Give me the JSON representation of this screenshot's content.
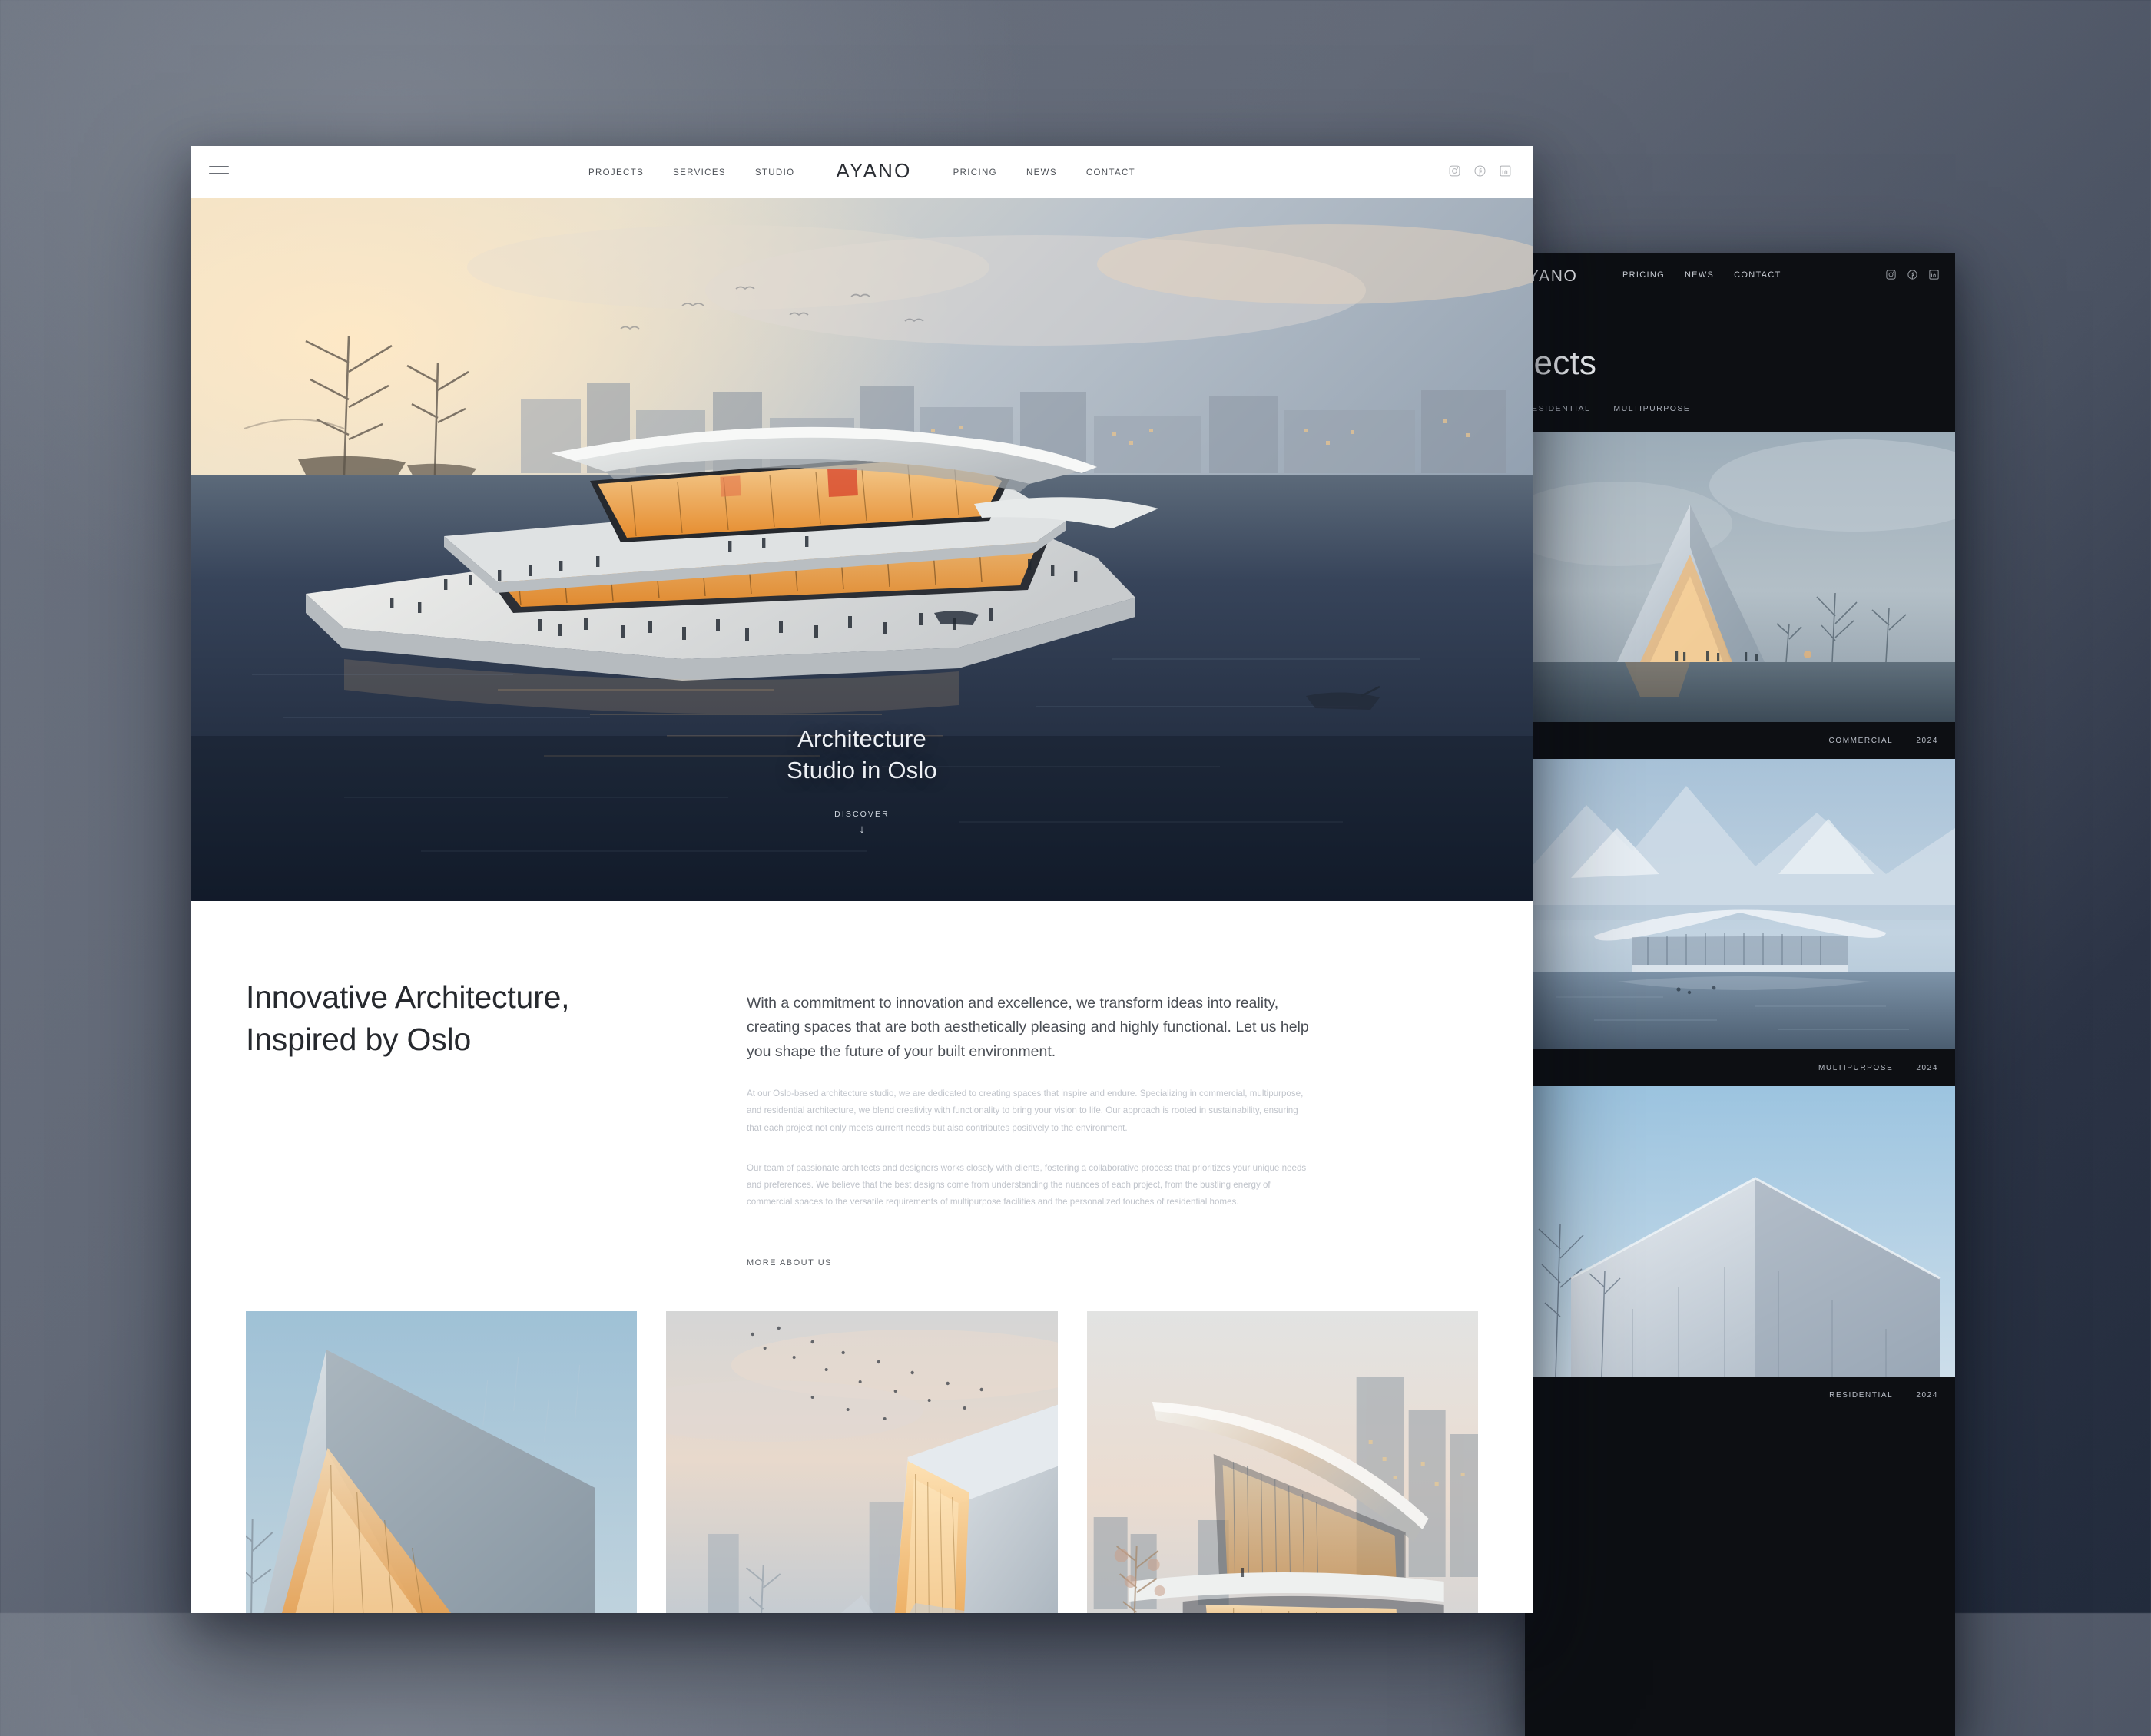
{
  "theme": {
    "page_bg_from": "#6d7481",
    "page_bg_to": "#222b3c",
    "light_surface": "#ffffff",
    "dark_surface": "#0d0f13",
    "accent_text": "#26292e"
  },
  "front_window": {
    "header": {
      "menu_icon": "hamburger-icon",
      "brand": "AYANO",
      "nav_left": [
        "PROJECTS",
        "SERVICES",
        "STUDIO"
      ],
      "nav_right": [
        "PRICING",
        "NEWS",
        "CONTACT"
      ],
      "socials": [
        "instagram-icon",
        "facebook-icon",
        "linkedin-icon"
      ]
    },
    "hero": {
      "title_line1": "Architecture",
      "title_line2": "Studio in Oslo",
      "discover_label": "DISCOVER",
      "scroll_arrow": "arrow-down-icon"
    },
    "about": {
      "heading_line1": "Innovative Architecture,",
      "heading_line2": "Inspired by Oslo",
      "lead": "With a commitment to innovation and excellence, we transform ideas into reality, creating spaces that are both aesthetically pleasing and highly functional. Let us help you shape the future of your built environment.",
      "paragraph1": "At our Oslo-based architecture studio, we are dedicated to creating spaces that inspire and endure. Specializing in commercial, multipurpose, and residential architecture, we blend creativity with functionality to bring your vision to life. Our approach is rooted in sustainability, ensuring that each project not only meets current needs but also contributes positively to the environment.",
      "paragraph2": "Our team of passionate architects and designers works closely with clients, fostering a collaborative process that prioritizes your unique needs and preferences. We believe that the best designs come from understanding the nuances of each project, from the bustling energy of commercial spaces to the versatile requirements of multipurpose facilities and the personalized touches of residential homes.",
      "cta_label": "MORE ABOUT US"
    },
    "gallery": [
      {
        "name": "angular-glass-pavilion"
      },
      {
        "name": "folded-roof-cultural-center"
      },
      {
        "name": "curved-canopy-residence"
      }
    ]
  },
  "back_window": {
    "header": {
      "brand": "AYANO",
      "nav_right": [
        "PRICING",
        "NEWS",
        "CONTACT"
      ],
      "socials": [
        "instagram-icon",
        "facebook-icon",
        "linkedin-icon"
      ]
    },
    "page_title": "Projects",
    "filters": [
      "RESIDENTIAL",
      "MULTIPURPOSE"
    ],
    "projects": [
      {
        "category": "COMMERCIAL",
        "year": "2024"
      },
      {
        "category": "MULTIPURPOSE",
        "year": "2024"
      },
      {
        "category": "RESIDENTIAL",
        "year": "2024"
      }
    ]
  }
}
